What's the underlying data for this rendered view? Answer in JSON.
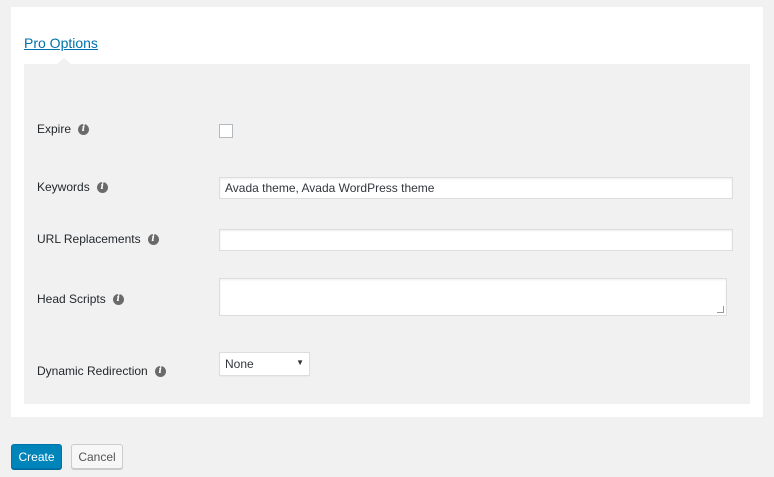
{
  "section": {
    "title": "Pro Options"
  },
  "fields": {
    "expire": {
      "label": "Expire",
      "checked": false
    },
    "keywords": {
      "label": "Keywords",
      "value": "Avada theme, Avada WordPress theme"
    },
    "url_replacements": {
      "label": "URL Replacements",
      "value": ""
    },
    "head_scripts": {
      "label": "Head Scripts",
      "value": ""
    },
    "dynamic_redirection": {
      "label": "Dynamic Redirection",
      "selected": "None"
    }
  },
  "icons": {
    "info": "info-icon"
  },
  "buttons": {
    "create": "Create",
    "cancel": "Cancel"
  },
  "colors": {
    "primary": "#0085ba",
    "link": "#0073aa",
    "panel_bg": "#f1f1f1"
  }
}
